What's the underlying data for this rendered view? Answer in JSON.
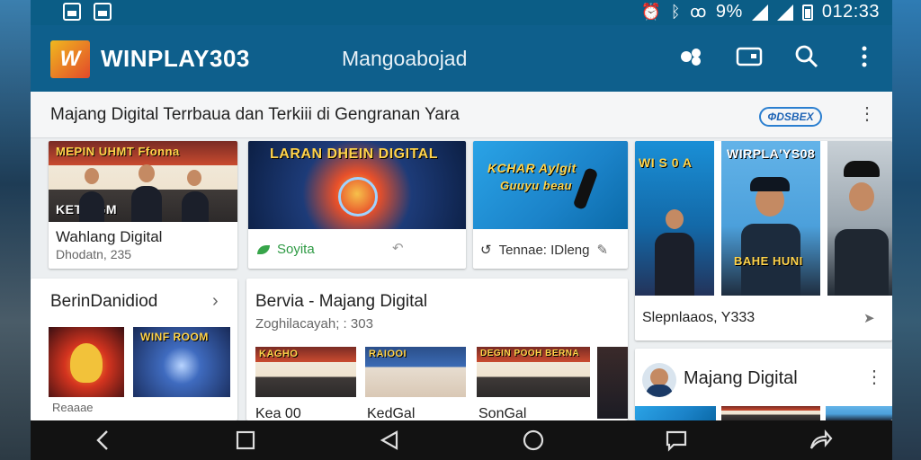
{
  "status_bar": {
    "time": "012:33",
    "battery_text": "9%",
    "extra_text": "ꝏ"
  },
  "app_bar": {
    "logo_letter": "W",
    "brand": "WINPLAY303",
    "title": "Mangoabojad",
    "actions": [
      "cast-icon",
      "gallery-icon",
      "search-icon",
      "more-vert-icon"
    ]
  },
  "section": {
    "title": "Majang Digital Terrbaua dan Terkiii di Gengranan Yara",
    "badge": "ΦDSBEX"
  },
  "cards_row1": [
    {
      "banner": "MEPIN UHMT Ffonna",
      "banner2": "KETRIGM",
      "title": "Wahlang Digital",
      "sub": "Dhodatn, 235"
    },
    {
      "banner": "LARAN DHEIN DIGITAL",
      "status": "Soyita"
    },
    {
      "banner": "KCHAR Aylgit",
      "banner2": "Guuyu beau",
      "status": "Tennae: IDleng"
    },
    {
      "banner": "WI S 0 A",
      "banner2": "WIRPLA'YS08",
      "banner3": "BAHE HUNI",
      "title": "Slepnlaaos, Y333"
    }
  ],
  "left_panel": {
    "title": "BerinDanidiod",
    "thumb1_text": "",
    "thumb2_text": "WINF ROOM",
    "caption": "Reaaae"
  },
  "middle_panel": {
    "title": "Bervia - Majang Digital",
    "sub": "Zoghilacayah; : 303",
    "thumb_labels": [
      "Kea 00",
      "KedGal",
      "SonGal"
    ],
    "thumb_banners": [
      "KAGHO",
      "RAIOOI",
      "DEGIN POOH BERNA"
    ]
  },
  "right_panel": {
    "title": "Majang Digital"
  },
  "nav_bar": {
    "buttons": [
      "back-icon",
      "square-icon",
      "triangle-back-icon",
      "home-circle-icon",
      "chat-icon",
      "share-icon"
    ]
  }
}
